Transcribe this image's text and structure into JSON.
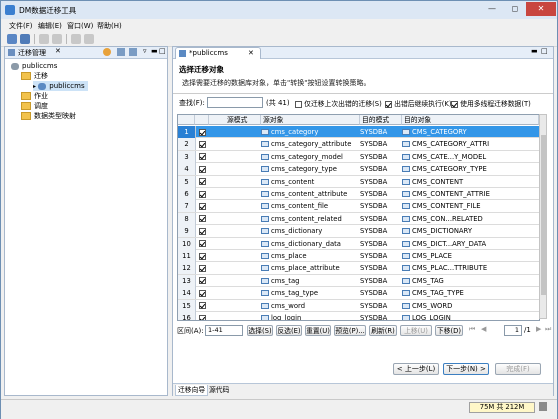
{
  "window": {
    "title": "DM数据迁移工具"
  },
  "menu": [
    "文件(F)",
    "编辑(E)",
    "窗口(W)",
    "帮助(H)"
  ],
  "left_panel": {
    "title": "迁移管理",
    "tree": [
      {
        "label": "publiccms",
        "level": 0,
        "icon": "database-icon"
      },
      {
        "label": "迁移",
        "level": 1,
        "icon": "folder-icon"
      },
      {
        "label": "publiccms",
        "level": 2,
        "icon": "migration-icon"
      },
      {
        "label": "作业",
        "level": 1,
        "icon": "folder-icon"
      },
      {
        "label": "调度",
        "level": 1,
        "icon": "folder-icon"
      },
      {
        "label": "数据类型映射",
        "level": 1,
        "icon": "folder-icon"
      }
    ]
  },
  "editor": {
    "tab": "*publiccms",
    "header_title": "选择迁移对象",
    "header_desc": "选择需要迁移的数据库对象，单击\"转换\"按钮设置转换策略。",
    "search_label": "查找(F):",
    "search_value": "",
    "total": "(共 41)",
    "options": [
      {
        "label": "仅迁移上次出错的迁移(S)",
        "checked": false
      },
      {
        "label": "出错后继续执行(K)",
        "checked": true
      },
      {
        "label": "使用多线程迁移数据(T)",
        "checked": true
      }
    ],
    "columns": [
      "",
      "",
      "源模式",
      "源对象",
      "目的模式",
      "目的对象"
    ],
    "rows": [
      [
        "1",
        "",
        "cms_category",
        "SYSDBA",
        "CMS_CATEGORY"
      ],
      [
        "2",
        "",
        "cms_category_attribute",
        "SYSDBA",
        "CMS_CATEGORY_ATTRI"
      ],
      [
        "3",
        "",
        "cms_category_model",
        "SYSDBA",
        "CMS_CATE...Y_MODEL"
      ],
      [
        "4",
        "",
        "cms_category_type",
        "SYSDBA",
        "CMS_CATEGORY_TYPE"
      ],
      [
        "5",
        "",
        "cms_content",
        "SYSDBA",
        "CMS_CONTENT"
      ],
      [
        "6",
        "",
        "cms_content_attribute",
        "SYSDBA",
        "CMS_CONTENT_ATTRIE"
      ],
      [
        "7",
        "",
        "cms_content_file",
        "SYSDBA",
        "CMS_CONTENT_FILE"
      ],
      [
        "8",
        "",
        "cms_content_related",
        "SYSDBA",
        "CMS_CON...RELATED"
      ],
      [
        "9",
        "",
        "cms_dictionary",
        "SYSDBA",
        "CMS_DICTIONARY"
      ],
      [
        "10",
        "",
        "cms_dictionary_data",
        "SYSDBA",
        "CMS_DICT...ARY_DATA"
      ],
      [
        "11",
        "",
        "cms_place",
        "SYSDBA",
        "CMS_PLACE"
      ],
      [
        "12",
        "",
        "cms_place_attribute",
        "SYSDBA",
        "CMS_PLAC...TTRIBUTE"
      ],
      [
        "13",
        "",
        "cms_tag",
        "SYSDBA",
        "CMS_TAG"
      ],
      [
        "14",
        "",
        "cms_tag_type",
        "SYSDBA",
        "CMS_TAG_TYPE"
      ],
      [
        "15",
        "",
        "cms_word",
        "SYSDBA",
        "CMS_WORD"
      ],
      [
        "16",
        "",
        "log_login",
        "SYSDBA",
        "LOG_LOGIN"
      ]
    ],
    "pager": {
      "range_label": "区间(A):",
      "range_value": "1-41",
      "buttons": [
        "选择(S)",
        "反选(E)",
        "重置(U)",
        "预览(P)...",
        "刷新(R)",
        "上移(U)",
        "下移(D)"
      ],
      "page_value": "1",
      "page_total": "/1"
    },
    "nav": {
      "back": "< 上一步(L)",
      "next": "下一步(N) >",
      "finish": "完成(F)"
    },
    "bottom_tabs": [
      "迁移向导",
      "源代码"
    ]
  },
  "status": {
    "memory": "75M 共 212M"
  }
}
